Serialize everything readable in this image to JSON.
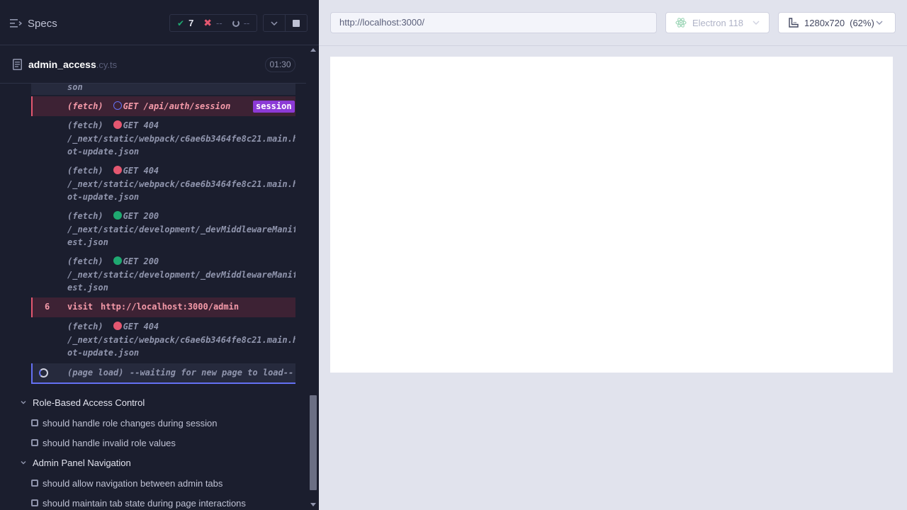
{
  "header": {
    "specs_label": "Specs",
    "stats": {
      "passed": "7",
      "failed": "--",
      "pending": "--"
    }
  },
  "spec": {
    "name": "admin_access",
    "ext": ".cy.ts",
    "duration": "01:30"
  },
  "command_log": {
    "top_fragment": "son",
    "session": {
      "name": "(fetch)",
      "method": "GET",
      "path": "/api/auth/session",
      "badge": "session"
    },
    "fetches_a": [
      {
        "name": "(fetch)",
        "status": "GET 404",
        "line1": "/_next/static/webpack/c6ae6b3464fe8c21.main.h",
        "line2": "ot-update.json",
        "color": "red"
      },
      {
        "name": "(fetch)",
        "status": "GET 404",
        "line1": "/_next/static/webpack/c6ae6b3464fe8c21.main.h",
        "line2": "ot-update.json",
        "color": "red"
      },
      {
        "name": "(fetch)",
        "status": "GET 200",
        "line1": "/_next/static/development/_devMiddlewareManif",
        "line2": "est.json",
        "color": "green"
      },
      {
        "name": "(fetch)",
        "status": "GET 200",
        "line1": "/_next/static/development/_devMiddlewareManif",
        "line2": "est.json",
        "color": "green"
      }
    ],
    "visit": {
      "num": "6",
      "name": "visit",
      "url": "http://localhost:3000/admin"
    },
    "fetch_b": {
      "name": "(fetch)",
      "status": "GET 404",
      "line1": "/_next/static/webpack/c6ae6b3464fe8c21.main.h",
      "line2": "ot-update.json",
      "color": "red"
    },
    "page_load": {
      "name": "(page load)",
      "message": "--waiting for new page to load--"
    }
  },
  "suites": [
    {
      "title": "Role-Based Access Control",
      "tests": [
        "should handle role changes during session",
        "should handle invalid role values"
      ]
    },
    {
      "title": "Admin Panel Navigation",
      "tests": [
        "should allow navigation between admin tabs",
        "should maintain tab state during page interactions"
      ]
    }
  ],
  "aut": {
    "url": "http://localhost:3000/",
    "browser": "Electron 118",
    "viewport": "1280x720",
    "zoom": "(62%)"
  },
  "colors": {
    "reporter_bg": "#1b1e2e",
    "failed_bg": "#3d2234",
    "failed_accent": "#e45770",
    "passed": "#1fa971",
    "running_accent": "#6470f3",
    "badge": "#8c3ad6"
  },
  "icons": [
    "specs-list-icon",
    "check-icon",
    "x-icon",
    "pending-icon",
    "chevron-down-icon",
    "stop-icon",
    "file-icon",
    "electron-icon",
    "viewport-icon"
  ]
}
